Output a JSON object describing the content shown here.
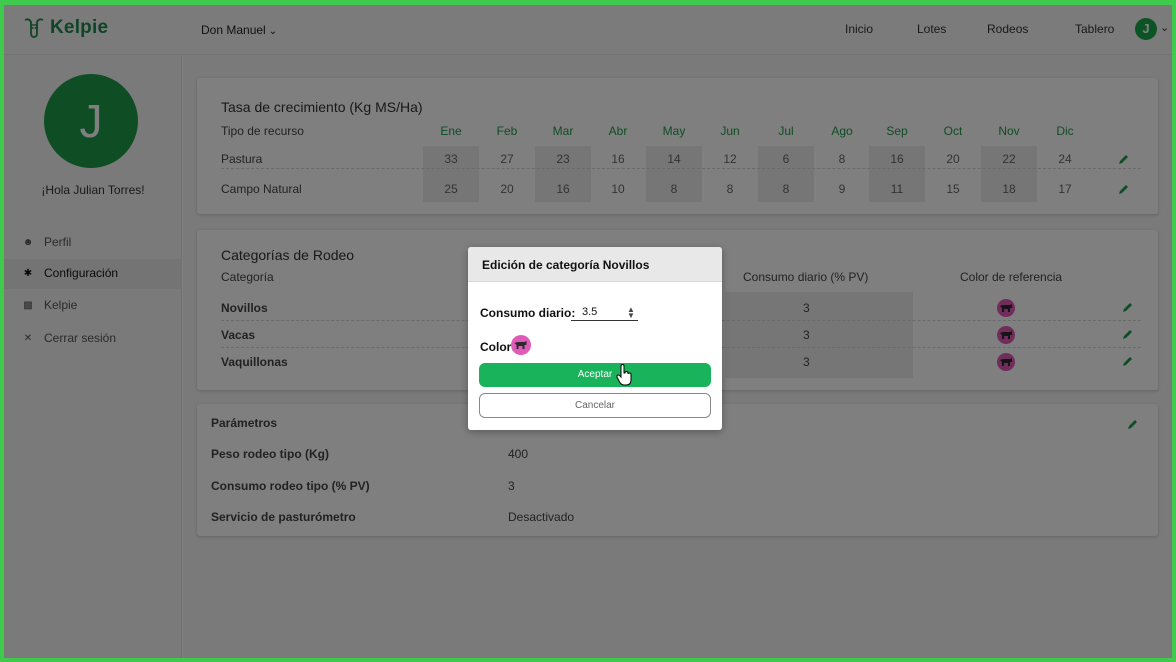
{
  "app": {
    "name": "Kelpie"
  },
  "header": {
    "farm": "Don Manuel",
    "nav": [
      "Inicio",
      "Lotes",
      "Rodeos",
      "Tablero"
    ],
    "avatar_letter": "J"
  },
  "sidebar": {
    "avatar_letter": "J",
    "greeting": "¡Hola Julian Torres!",
    "items": [
      {
        "label": "Perfil",
        "icon": "user-icon"
      },
      {
        "label": "Configuración",
        "icon": "gear-icon"
      },
      {
        "label": "Kelpie",
        "icon": "building-icon"
      },
      {
        "label": "Cerrar sesión",
        "icon": "close-icon"
      }
    ]
  },
  "growth": {
    "title": "Tasa de crecimiento (Kg MS/Ha)",
    "resource_header": "Tipo de recurso",
    "months": [
      "Ene",
      "Feb",
      "Mar",
      "Abr",
      "May",
      "Jun",
      "Jul",
      "Ago",
      "Sep",
      "Oct",
      "Nov",
      "Dic"
    ],
    "rows": [
      {
        "name": "Pastura",
        "values": [
          "33",
          "27",
          "23",
          "16",
          "14",
          "12",
          "6",
          "8",
          "16",
          "20",
          "22",
          "24"
        ]
      },
      {
        "name": "Campo Natural",
        "values": [
          "25",
          "20",
          "16",
          "10",
          "8",
          "8",
          "8",
          "9",
          "11",
          "15",
          "18",
          "17"
        ]
      }
    ]
  },
  "categories": {
    "title": "Categorías de Rodeo",
    "col_category": "Categoría",
    "col_consumption": "Consumo diario (% PV)",
    "col_color": "Color de referencia",
    "rows": [
      {
        "name": "Novillos",
        "consumption": "3",
        "color": "#e05bb7"
      },
      {
        "name": "Vacas",
        "consumption": "3",
        "color": "#e05bb7"
      },
      {
        "name": "Vaquillonas",
        "consumption": "3",
        "color": "#e05bb7"
      }
    ]
  },
  "params": {
    "title": "Parámetros",
    "rows": [
      {
        "label": "Peso rodeo tipo (Kg)",
        "value": "400"
      },
      {
        "label": "Consumo rodeo tipo (% PV)",
        "value": "3"
      },
      {
        "label": "Servicio de pasturómetro",
        "value": "Desactivado"
      }
    ]
  },
  "modal": {
    "title": "Edición de categoría Novillos",
    "consumption_label": "Consumo diario:",
    "consumption_value": "3.5",
    "color_label": "Color:",
    "ok_label": "Aceptar",
    "cancel_label": "Cancelar"
  },
  "colors": {
    "brand": "#1f9a4b",
    "accept": "#19b35c",
    "cow": "#e05bb7"
  }
}
